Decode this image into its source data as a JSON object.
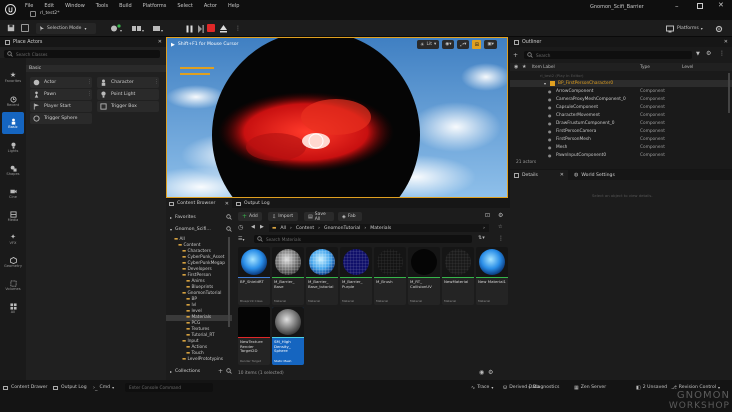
{
  "app": {
    "tab_title": "rl_test2*",
    "project_name": "Gnomon_Scifi_Barrier"
  },
  "menu": [
    "File",
    "Edit",
    "Window",
    "Tools",
    "Build",
    "Platforms",
    "Select",
    "Actor",
    "Help"
  ],
  "toolbar": {
    "save_label": "Save",
    "selection_mode": "Selection Mode",
    "platforms": "Platforms"
  },
  "place_actors": {
    "title": "Place Actors",
    "search_placeholder": "Search Classes",
    "category": "Basic",
    "items": [
      "Actor",
      "Character",
      "Pawn",
      "Point Light",
      "Player Start",
      "Trigger Box",
      "Trigger Sphere"
    ],
    "side": [
      "Favorites",
      "Recent",
      "Basic",
      "Lights",
      "Shapes",
      "Cine",
      "Media",
      "VFX",
      "Geometry",
      "Volumes",
      "All"
    ]
  },
  "viewport": {
    "hint": "Shift+F1 for Mouse Cursor",
    "lit": "Lit"
  },
  "outliner": {
    "title": "Outliner",
    "search_placeholder": "Search",
    "col_label": "Item Label",
    "col_type": "Type",
    "col_level": "Level",
    "rows": [
      {
        "name": "rl_test2 (Play In Editor)",
        "type": ""
      },
      {
        "name": "BP_FirstPersonCharacter0",
        "type": ""
      },
      {
        "name": "ArrowComponent",
        "type": "Component"
      },
      {
        "name": "CameraProxyMeshComponent_0",
        "type": "Component"
      },
      {
        "name": "CapsuleComponent",
        "type": "Component"
      },
      {
        "name": "CharacterMovement",
        "type": "Component"
      },
      {
        "name": "DrawFrustumComponent_0",
        "type": "Component"
      },
      {
        "name": "FirstPersonCamera",
        "type": "Component"
      },
      {
        "name": "FirstPersonMesh",
        "type": "Component"
      },
      {
        "name": "Mesh",
        "type": "Component"
      },
      {
        "name": "PawnInputComponent0",
        "type": "Component"
      }
    ],
    "count": "21 actors"
  },
  "details": {
    "tab_details": "Details",
    "tab_world": "World Settings",
    "empty": "Select an object to view details."
  },
  "content": {
    "title": "Content Browser",
    "output_tab": "Output Log",
    "add": "Add",
    "import": "Import",
    "save_all": "Save All",
    "fab": "Fab",
    "favorites": "Favorites",
    "project": "Gnomon_Scifi...",
    "path": [
      "All",
      "Content",
      "GnomonTutorial",
      "Materials"
    ],
    "search_placeholder": "Search Materials",
    "tree": [
      "All",
      "Content",
      "Characters",
      "CyberPunk_Asset",
      "CyberPunkMegap",
      "Developers",
      "FirstPerson",
      "Anims",
      "Blueprints",
      "GnomonTutorial",
      "BP",
      "lvl",
      "level",
      "Materials",
      "PCG",
      "Textures",
      "Tutorial_RT",
      "Input",
      "Actions",
      "Touch",
      "LevelPrototypins"
    ],
    "collections": "Collections",
    "status": "10 items (1 selected)",
    "assets": [
      {
        "name": "BP_ShieldRT",
        "type": "Blueprint Class"
      },
      {
        "name": "M_Barrier_ Base",
        "type": "Material"
      },
      {
        "name": "M_Barrier_ Base_tutorial",
        "type": "Material"
      },
      {
        "name": "M_Barrier_ Purple",
        "type": "Material"
      },
      {
        "name": "M_Brush",
        "type": "Material"
      },
      {
        "name": "M_RT_ CollisionUV",
        "type": "Material"
      },
      {
        "name": "NewMaterial",
        "type": "Material"
      },
      {
        "name": "New Material1",
        "type": "Material"
      },
      {
        "name": "NewTexture Render Target2D",
        "type": "Render Target"
      },
      {
        "name": "SM_High Density_ Sphere",
        "type": "Static Mesh"
      }
    ]
  },
  "bottom": {
    "drawer": "Content Drawer",
    "output": "Output Log",
    "cmd": "Cmd",
    "console_placeholder": "Enter Console Command",
    "trace": "Trace",
    "derived": "Derived Data",
    "diagnostics": "Diagnostics",
    "zen": "Zen Server",
    "unsaved": "2 Unsaved",
    "revision": "Revision Control",
    "watermark1": "GNOMON",
    "watermark2": "WORKSHOP"
  },
  "colors": {
    "accent": "#1565c0",
    "selection_border": "#e0a020",
    "red": "#e02828"
  }
}
